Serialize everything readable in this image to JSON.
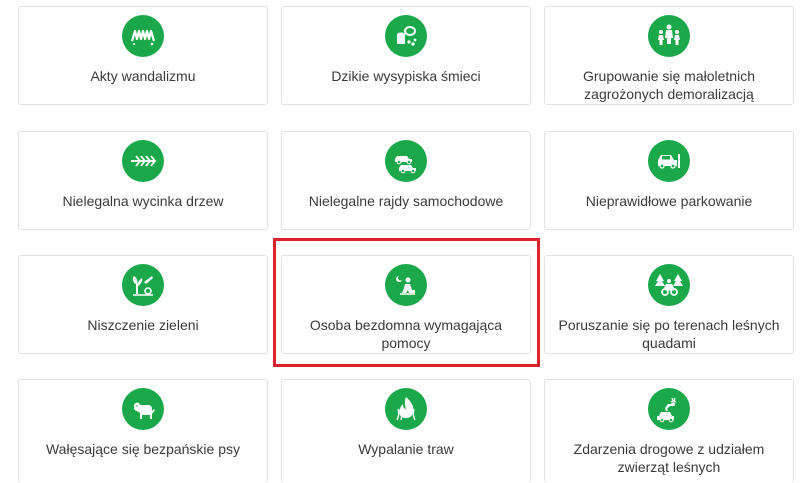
{
  "colors": {
    "icon_green": "#1aa84b",
    "highlight_red": "#d9232d",
    "card_border": "#e2e2e2",
    "text": "#3a3a3a"
  },
  "cards": [
    {
      "label": "Akty wandalizmu",
      "icon": "graffiti-icon"
    },
    {
      "label": "Dzikie wysypiska śmieci",
      "icon": "trash-dump-icon"
    },
    {
      "label": "Grupowanie się małoletnich zagrożonych demoralizacją",
      "icon": "youth-group-icon"
    },
    {
      "label": "Nielegalna wycinka drzew",
      "icon": "tree-felling-icon"
    },
    {
      "label": "Nielegalne rajdy samochodowe",
      "icon": "car-rally-icon"
    },
    {
      "label": "Nieprawidłowe parkowanie",
      "icon": "parking-icon"
    },
    {
      "label": "Niszczenie zieleni",
      "icon": "greenery-damage-icon"
    },
    {
      "label": "Osoba bezdomna wymagająca pomocy",
      "icon": "homeless-person-icon"
    },
    {
      "label": "Poruszanie się po terenach leśnych quadami",
      "icon": "quad-forest-icon"
    },
    {
      "label": "Wałęsające się bezpańskie psy",
      "icon": "stray-dog-icon"
    },
    {
      "label": "Wypalanie traw",
      "icon": "grass-burning-icon"
    },
    {
      "label": "Zdarzenia drogowe z udziałem zwierząt leśnych",
      "icon": "deer-collision-icon"
    }
  ]
}
